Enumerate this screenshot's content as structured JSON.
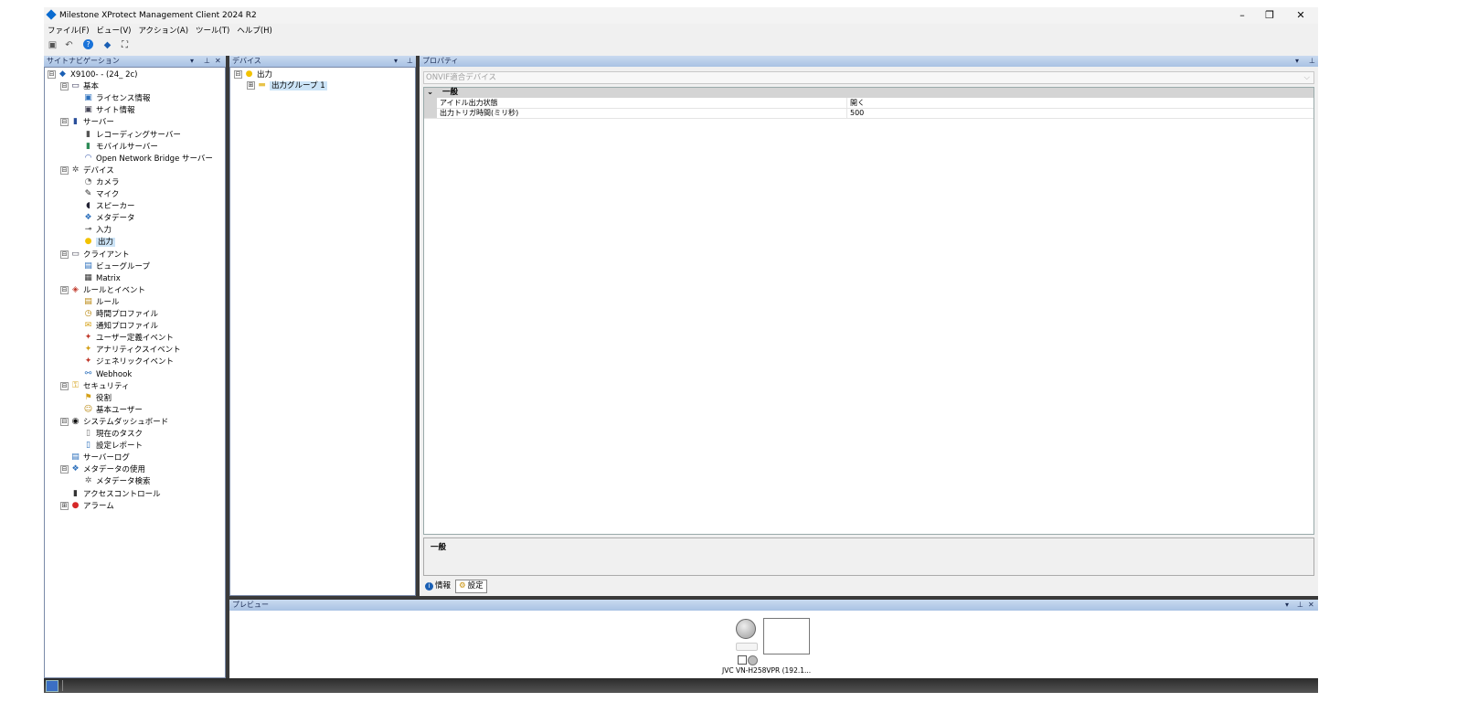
{
  "window": {
    "title": "Milestone XProtect Management Client 2024 R2",
    "minimize": "–",
    "restore": "❐",
    "close": "✕"
  },
  "menu": [
    "ファイル(F)",
    "ビュー(V)",
    "アクション(A)",
    "ツール(T)",
    "ヘルプ(H)"
  ],
  "toolbar": {
    "icons": [
      "save-icon",
      "undo-icon",
      "help-icon",
      "connect-icon",
      "find-icon"
    ]
  },
  "site_nav": {
    "header": "サイトナビゲーション",
    "tree": [
      {
        "label": "X9100-         - (24_ 2c)",
        "depth": 0,
        "expander": "⊟",
        "icon": "server-root-icon",
        "glyph": "◆",
        "color": "#1a5fb4"
      },
      {
        "label": "基本",
        "depth": 1,
        "expander": "⊟",
        "icon": "book-icon",
        "glyph": "▭",
        "color": "#335"
      },
      {
        "label": "ライセンス情報",
        "depth": 2,
        "icon": "license-icon",
        "glyph": "▣",
        "color": "#2a6ebb"
      },
      {
        "label": "サイト情報",
        "depth": 2,
        "icon": "site-info-icon",
        "glyph": "▣",
        "color": "#445"
      },
      {
        "label": "サーバー",
        "depth": 1,
        "expander": "⊟",
        "icon": "server-icon",
        "glyph": "▮",
        "color": "#2a4f9a"
      },
      {
        "label": "レコーディングサーバー",
        "depth": 2,
        "icon": "recording-server-icon",
        "glyph": "▮",
        "color": "#555"
      },
      {
        "label": "モバイルサーバー",
        "depth": 2,
        "icon": "mobile-server-icon",
        "glyph": "▮",
        "color": "#2e8b57"
      },
      {
        "label": "Open Network Bridge サーバー",
        "depth": 2,
        "icon": "bridge-icon",
        "glyph": "◠",
        "color": "#3355aa"
      },
      {
        "label": "デバイス",
        "depth": 1,
        "expander": "⊟",
        "icon": "devices-icon",
        "glyph": "✲",
        "color": "#555"
      },
      {
        "label": "カメラ",
        "depth": 2,
        "icon": "camera-icon",
        "glyph": "◔",
        "color": "#666"
      },
      {
        "label": "マイク",
        "depth": 2,
        "icon": "microphone-icon",
        "glyph": "✎",
        "color": "#222"
      },
      {
        "label": "スピーカー",
        "depth": 2,
        "icon": "speaker-icon",
        "glyph": "◖",
        "color": "#223"
      },
      {
        "label": "メタデータ",
        "depth": 2,
        "icon": "metadata-icon",
        "glyph": "❖",
        "color": "#2a6ebb"
      },
      {
        "label": "入力",
        "depth": 2,
        "icon": "input-icon",
        "glyph": "⊸",
        "color": "#222"
      },
      {
        "label": "出力",
        "depth": 2,
        "icon": "output-bulb-icon",
        "glyph": "●",
        "color": "#f2c200",
        "selected": true
      },
      {
        "label": "クライアント",
        "depth": 1,
        "expander": "⊟",
        "icon": "client-icon",
        "glyph": "▭",
        "color": "#445"
      },
      {
        "label": "ビューグループ",
        "depth": 2,
        "icon": "view-group-icon",
        "glyph": "▤",
        "color": "#2a6ebb"
      },
      {
        "label": "Matrix",
        "depth": 2,
        "icon": "matrix-icon",
        "glyph": "▦",
        "color": "#333"
      },
      {
        "label": "ルールとイベント",
        "depth": 1,
        "expander": "⊟",
        "icon": "rules-events-icon",
        "glyph": "◈",
        "color": "#c0392b"
      },
      {
        "label": "ルール",
        "depth": 2,
        "icon": "rule-icon",
        "glyph": "▤",
        "color": "#b8860b"
      },
      {
        "label": "時間プロファイル",
        "depth": 2,
        "icon": "time-profile-icon",
        "glyph": "◷",
        "color": "#b8860b"
      },
      {
        "label": "通知プロファイル",
        "depth": 2,
        "icon": "notification-profile-icon",
        "glyph": "✉",
        "color": "#d4a017"
      },
      {
        "label": "ユーザー定義イベント",
        "depth": 2,
        "icon": "user-event-icon",
        "glyph": "✦",
        "color": "#c0392b"
      },
      {
        "label": "アナリティクスイベント",
        "depth": 2,
        "icon": "analytics-event-icon",
        "glyph": "✦",
        "color": "#d4a017"
      },
      {
        "label": "ジェネリックイベント",
        "depth": 2,
        "icon": "generic-event-icon",
        "glyph": "✦",
        "color": "#c0392b"
      },
      {
        "label": "Webhook",
        "depth": 2,
        "icon": "webhook-icon",
        "glyph": "⚯",
        "color": "#2a6ebb"
      },
      {
        "label": "セキュリティ",
        "depth": 1,
        "expander": "⊟",
        "icon": "security-icon",
        "glyph": "⚿",
        "color": "#d4a017"
      },
      {
        "label": "役割",
        "depth": 2,
        "icon": "role-icon",
        "glyph": "⚑",
        "color": "#d4a017"
      },
      {
        "label": "基本ユーザー",
        "depth": 2,
        "icon": "basic-user-icon",
        "glyph": "☺",
        "color": "#b8860b"
      },
      {
        "label": "システムダッシュボード",
        "depth": 1,
        "expander": "⊟",
        "icon": "dashboard-icon",
        "glyph": "◉",
        "color": "#111"
      },
      {
        "label": "現在のタスク",
        "depth": 2,
        "icon": "current-tasks-icon",
        "glyph": "▯",
        "color": "#777"
      },
      {
        "label": "設定レポート",
        "depth": 2,
        "icon": "config-report-icon",
        "glyph": "▯",
        "color": "#2a6ebb"
      },
      {
        "label": "サーバーログ",
        "depth": 1,
        "icon": "server-log-icon",
        "glyph": "▤",
        "color": "#2a6ebb"
      },
      {
        "label": "メタデータの使用",
        "depth": 1,
        "expander": "⊟",
        "icon": "metadata-use-icon",
        "glyph": "❖",
        "color": "#2a6ebb"
      },
      {
        "label": "メタデータ検索",
        "depth": 2,
        "icon": "metadata-search-icon",
        "glyph": "✲",
        "color": "#666"
      },
      {
        "label": "アクセスコントロール",
        "depth": 1,
        "icon": "access-control-icon",
        "glyph": "▮",
        "color": "#333"
      },
      {
        "label": "アラーム",
        "depth": 1,
        "expander": "⊞",
        "icon": "alarm-icon",
        "glyph": "●",
        "color": "#d62828"
      }
    ]
  },
  "devices": {
    "header": "デバイス",
    "tree": [
      {
        "label": "出力",
        "depth": 0,
        "expander": "⊟",
        "icon": "output-bulb-icon",
        "glyph": "●",
        "color": "#f2c200"
      },
      {
        "label": "出力グループ 1",
        "depth": 1,
        "expander": "⊞",
        "icon": "folder-icon",
        "glyph": "▬",
        "color": "#e8c34a",
        "selected": true
      }
    ]
  },
  "properties": {
    "header": "プロパティ",
    "combo": "ONVIF適合デバイス",
    "category": "一般",
    "rows": [
      {
        "key": "アイドル出力状態",
        "value": "開く"
      },
      {
        "key": "出力トリガ時間(ミリ秒)",
        "value": "500"
      }
    ],
    "description_title": "一般",
    "tabs": [
      {
        "label": "情報",
        "icon": "info-icon"
      },
      {
        "label": "設定",
        "icon": "settings-icon",
        "active": true
      }
    ]
  },
  "preview": {
    "header": "プレビュー",
    "device_label": "JVC VN-H258VPR (192.1..."
  },
  "pane_controls": {
    "dropdown": "▾",
    "pin": "⊥",
    "close": "✕"
  }
}
